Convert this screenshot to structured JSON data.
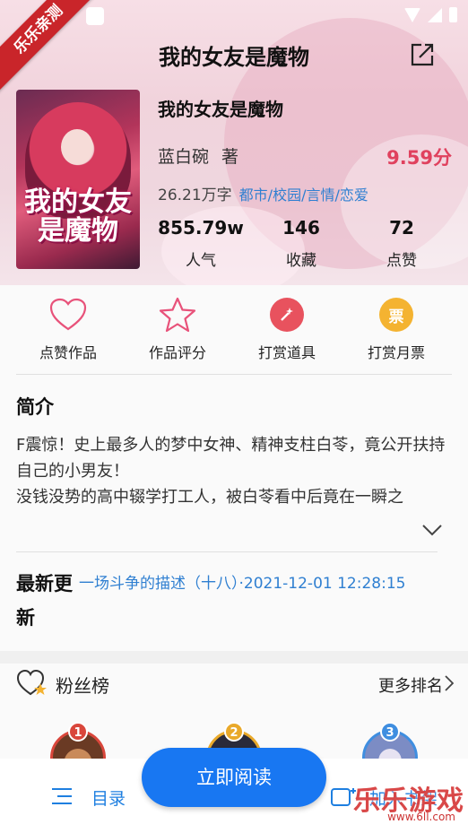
{
  "watermark": {
    "ribbon": "乐乐亲测",
    "corner": "乐乐游戏",
    "url": "www.6ll.com"
  },
  "header": {
    "title": "我的女友是魔物"
  },
  "cover": {
    "title_text": "我的女友是魔物"
  },
  "book": {
    "title": "我的女友是魔物",
    "author": "蓝白碗",
    "author_suffix": "著",
    "score": "9.59分",
    "words": "26.21万字",
    "tags": "都市/校园/言情/恋爱"
  },
  "stats": [
    {
      "value": "855.79w",
      "label": "人气"
    },
    {
      "value": "146",
      "label": "收藏"
    },
    {
      "value": "72",
      "label": "点赞"
    }
  ],
  "actions": [
    {
      "label": "点赞作品",
      "icon": "heart-icon"
    },
    {
      "label": "作品评分",
      "icon": "star-icon"
    },
    {
      "label": "打赏道具",
      "icon": "wand-icon"
    },
    {
      "label": "打赏月票",
      "icon": "ticket-icon",
      "glyph": "票"
    }
  ],
  "intro": {
    "heading": "简介",
    "text": "F震惊！史上最多人的梦中女神、精神支柱白苓，竟公开扶持自己的小男友！\n没钱没势的高中辍学打工人，被白苓看中后竟在一瞬之"
  },
  "latest": {
    "heading": "最新更新",
    "value": "一场斗争的描述（十八）·2021-12-01 12:28:15"
  },
  "fans": {
    "heading": "粉丝榜",
    "more": "更多排名",
    "ranks": [
      "1",
      "2",
      "3"
    ]
  },
  "bottom": {
    "toc": "目录",
    "read": "立即阅读",
    "shelf": "加入书架"
  },
  "colors": {
    "accent_blue": "#1877f2",
    "score_red": "#e0415e",
    "tag_blue": "#2f7fd1"
  }
}
